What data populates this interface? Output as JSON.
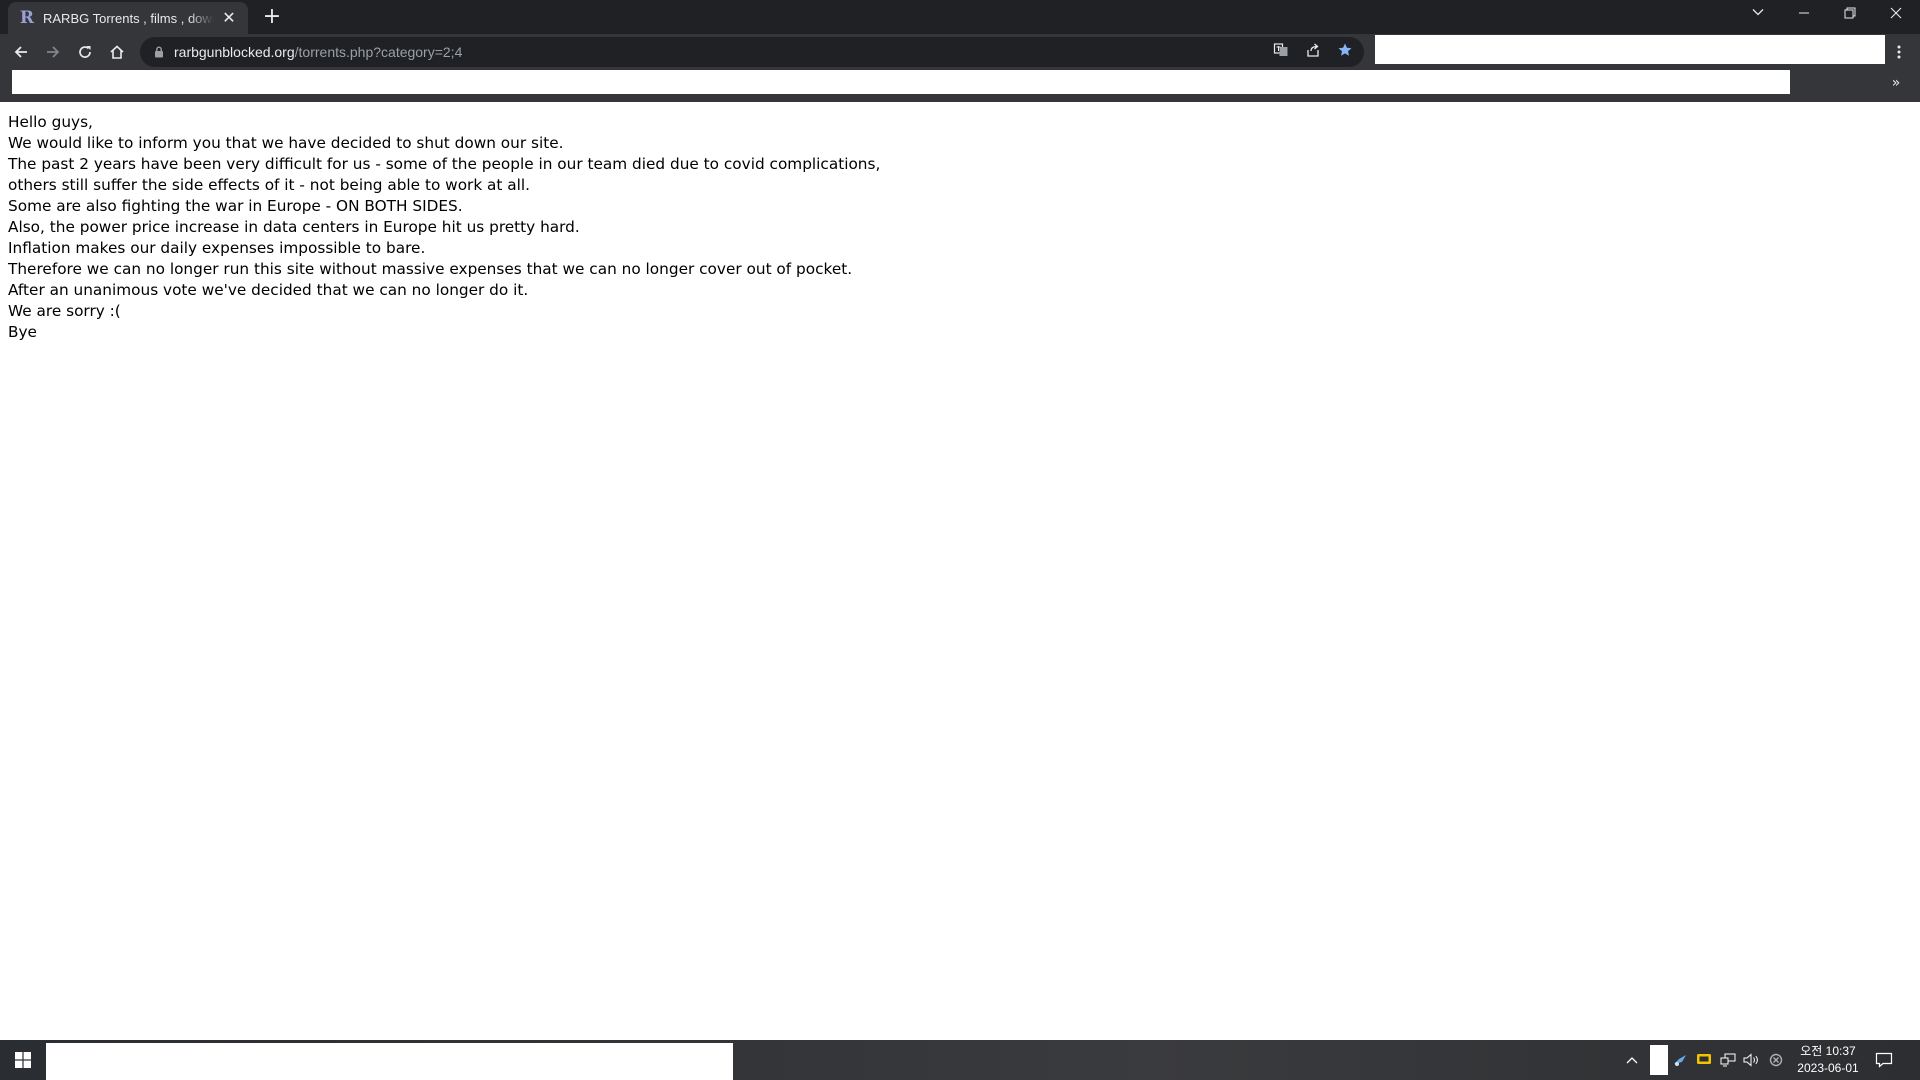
{
  "browser": {
    "tab": {
      "title": "RARBG Torrents , films , download",
      "favicon": "R"
    },
    "url_host": "rarbgunblocked.org",
    "url_path": "/torrents.php?category=2;4",
    "accent_color": "#8ab4f8"
  },
  "page": {
    "lines": [
      "Hello guys,",
      "We would like to inform you that we have decided to shut down our site.",
      "The past 2 years have been very difficult for us - some of the people in our team died due to covid complications,",
      "others still suffer the side effects of it - not being able to work at all.",
      "Some are also fighting the war in Europe - ON BOTH SIDES.",
      "Also, the power price increase in data centers in Europe hit us pretty hard.",
      "Inflation makes our daily expenses impossible to bare.",
      "Therefore we can no longer run this site without massive expenses that we can no longer cover out of pocket.",
      "After an unanimous vote we've decided that we can no longer do it.",
      "We are sorry :(",
      "Bye"
    ]
  },
  "taskbar": {
    "clock_time": "오전 10:37",
    "clock_date": "2023-06-01"
  }
}
